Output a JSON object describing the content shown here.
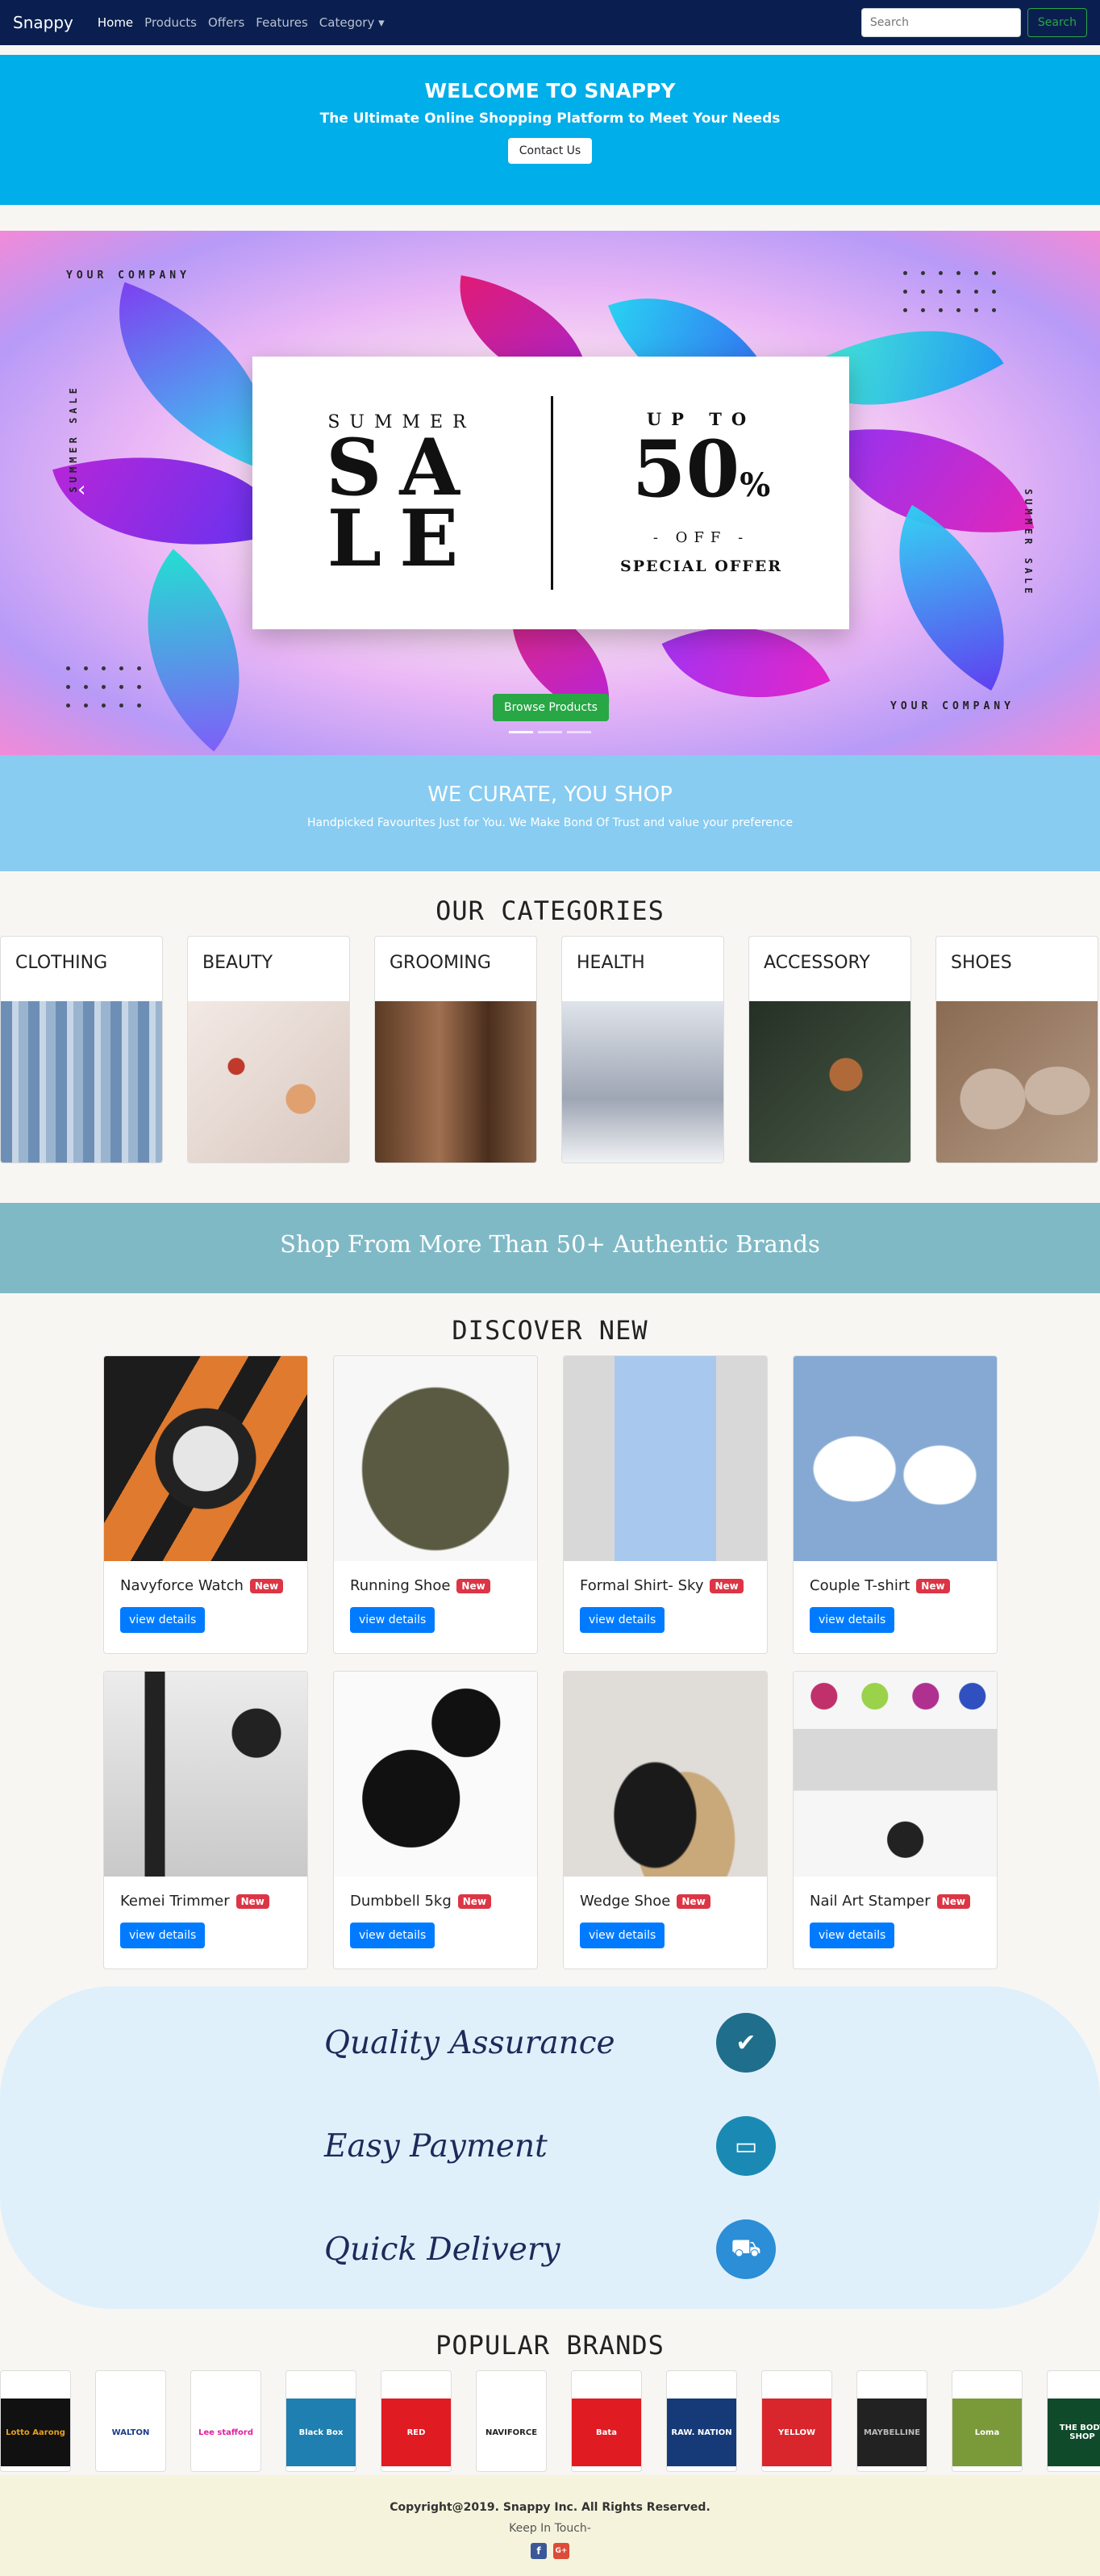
{
  "navbar": {
    "brand": "Snappy",
    "links": [
      "Home",
      "Products",
      "Offers",
      "Features",
      "Category ▾"
    ],
    "search_placeholder": "Search",
    "search_button": "Search"
  },
  "welcome": {
    "title": "WELCOME TO SNAPPY",
    "subtitle": "The Ultimate Online Shopping Platform to Meet Your Needs",
    "contact_button": "Contact Us"
  },
  "hero": {
    "your_company": "YOUR COMPANY",
    "summer_sale_vertical": "SUMMER SALE",
    "summer": "SUMMER",
    "sale_line1": "SA",
    "sale_line2": "LE",
    "up_to": "UP TO",
    "percent": "50",
    "percent_sign": "%",
    "off": "- OFF -",
    "special_offer": "SPECIAL OFFER",
    "browse_button": "Browse Products"
  },
  "curate": {
    "title": "WE CURATE, YOU SHOP",
    "subtitle": "Handpicked Favourites Just for You. We Make Bond Of Trust and value your preference"
  },
  "categories": {
    "heading": "OUR CATEGORIES",
    "items": [
      {
        "label": "CLOTHING",
        "color": "#8aa8c8"
      },
      {
        "label": "BEAUTY",
        "color": "#d9c9c2"
      },
      {
        "label": "GROOMING",
        "color": "#8a6b52"
      },
      {
        "label": "HEALTH",
        "color": "#c9cdd6"
      },
      {
        "label": "ACCESSORY",
        "color": "#3b4a3d"
      },
      {
        "label": "SHOES",
        "color": "#a08874"
      }
    ]
  },
  "brands_banner": "Shop From More Than 50+ Authentic Brands",
  "discover": {
    "heading": "DISCOVER NEW",
    "badge": "New",
    "button": "view details",
    "products": [
      {
        "name": "Navyforce Watch",
        "color": "#1f1f1f"
      },
      {
        "name": "Running Shoe",
        "color": "#f2f2f2"
      },
      {
        "name": "Formal Shirt- Sky",
        "color": "#a9c6e8"
      },
      {
        "name": "Couple T-shirt",
        "color": "#85a9d3"
      },
      {
        "name": "Kemei Trimmer",
        "color": "#e6e6e6"
      },
      {
        "name": "Dumbbell 5kg",
        "color": "#fafafa"
      },
      {
        "name": "Wedge Shoe",
        "color": "#d9d5d2"
      },
      {
        "name": "Nail Art Stamper",
        "color": "#f4f4f4"
      }
    ]
  },
  "features": [
    {
      "label": "Quality Assurance",
      "icon": "badge-check-icon",
      "color": "#1f6e8c"
    },
    {
      "label": "Easy Payment",
      "icon": "credit-card-icon",
      "color": "#1a8ab5"
    },
    {
      "label": "Quick Delivery",
      "icon": "delivery-truck-icon",
      "color": "#2b8ed6"
    }
  ],
  "popular_brands": {
    "heading": "POPULAR BRANDS",
    "items": [
      {
        "name": "Lotto Aarong",
        "color": "#111"
      },
      {
        "name": "WALTON",
        "color": "#ffffff"
      },
      {
        "name": "Lee stafford",
        "color": "#ffffff"
      },
      {
        "name": "Black Box",
        "color": "#1e7fb0"
      },
      {
        "name": "RED",
        "color": "#e11b22"
      },
      {
        "name": "NAVIFORCE",
        "color": "#ffffff"
      },
      {
        "name": "Bata",
        "color": "#e11b22"
      },
      {
        "name": "RAW. NATION",
        "color": "#163a78"
      },
      {
        "name": "YELLOW",
        "color": "#d8262c"
      },
      {
        "name": "MAYBELLINE",
        "color": "#222"
      },
      {
        "name": "Loma",
        "color": "#7a9a3a"
      },
      {
        "name": "THE BODY SHOP",
        "color": "#0f4a2a"
      }
    ]
  },
  "footer": {
    "copyright": "Copyright@2019. Snappy Inc. All Rights Reserved.",
    "keep_in_touch": "Keep In Touch-",
    "facebook": "f",
    "google": "G+"
  }
}
